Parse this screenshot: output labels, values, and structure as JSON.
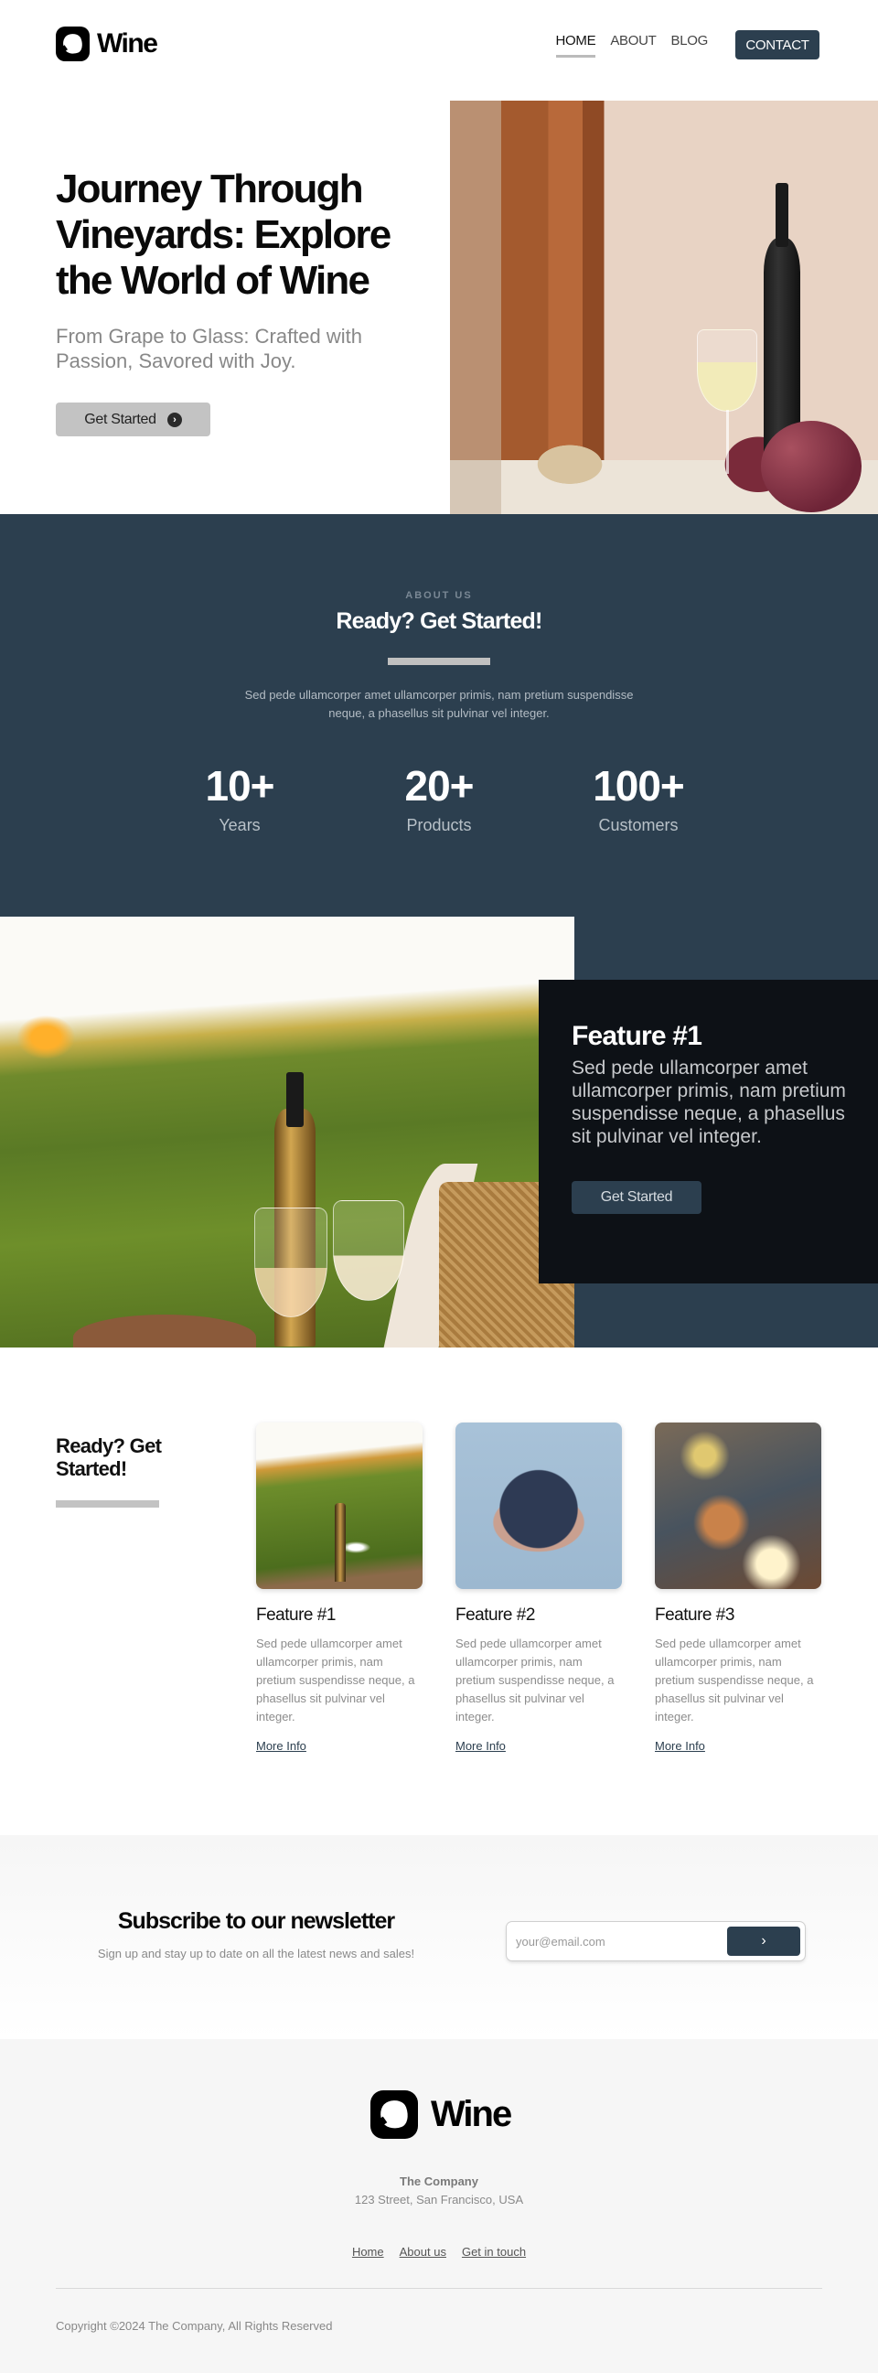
{
  "brand": {
    "name": "Wine",
    "icon": "wine-logo-icon"
  },
  "colors": {
    "primary": "#2c3f4f",
    "dark_card": "#0d1116",
    "accent_gray": "#c3c3c3",
    "footer_bg": "#f6f6f6"
  },
  "nav": {
    "items": [
      {
        "label": "HOME",
        "active": true
      },
      {
        "label": "ABOUT",
        "active": false
      },
      {
        "label": "BLOG",
        "active": false
      }
    ],
    "contact_label": "CONTACT"
  },
  "hero": {
    "title": "Journey Through Vineyards: Explore the World of Wine",
    "subtitle": "From Grape to Glass: Crafted with Passion, Savored with Joy.",
    "cta_label": "Get Started",
    "cta_icon": "chevron-right-circle-icon"
  },
  "about": {
    "eyebrow": "ABOUT US",
    "title": "Ready? Get Started!",
    "text": "Sed pede ullamcorper amet ullamcorper primis, nam pretium suspendisse neque, a phasellus sit pulvinar vel integer.",
    "stats": [
      {
        "value": "10+",
        "label": "Years"
      },
      {
        "value": "20+",
        "label": "Products"
      },
      {
        "value": "100+",
        "label": "Customers"
      }
    ]
  },
  "feature_band": {
    "title": "Feature #1",
    "text": "Sed pede ullamcorper amet ullamcorper primis, nam pretium suspendisse neque, a phasellus sit pulvinar vel integer.",
    "cta_label": "Get Started"
  },
  "cards_section": {
    "heading": "Ready? Get Started!",
    "cards": [
      {
        "title": "Feature #1",
        "text": "Sed pede ullamcorper amet ullamcorper primis, nam pretium suspendisse neque, a phasellus sit pulvinar vel integer.",
        "link": "More Info"
      },
      {
        "title": "Feature #2",
        "text": "Sed pede ullamcorper amet ullamcorper primis, nam pretium suspendisse neque, a phasellus sit pulvinar vel integer.",
        "link": "More Info"
      },
      {
        "title": "Feature #3",
        "text": "Sed pede ullamcorper amet ullamcorper primis, nam pretium suspendisse neque, a phasellus sit pulvinar vel integer.",
        "link": "More Info"
      }
    ]
  },
  "newsletter": {
    "title": "Subscribe to our newsletter",
    "subtitle": "Sign up and stay up to date on all the latest news and sales!",
    "email_value": "",
    "email_placeholder": "your@email.com",
    "submit_icon": "›"
  },
  "footer": {
    "company": "The Company",
    "address": "123 Street, San Francisco, USA",
    "links": [
      "Home",
      "About us",
      "Get in touch"
    ],
    "copyright": "Copyright ©2024 The Company, All Rights Reserved"
  }
}
